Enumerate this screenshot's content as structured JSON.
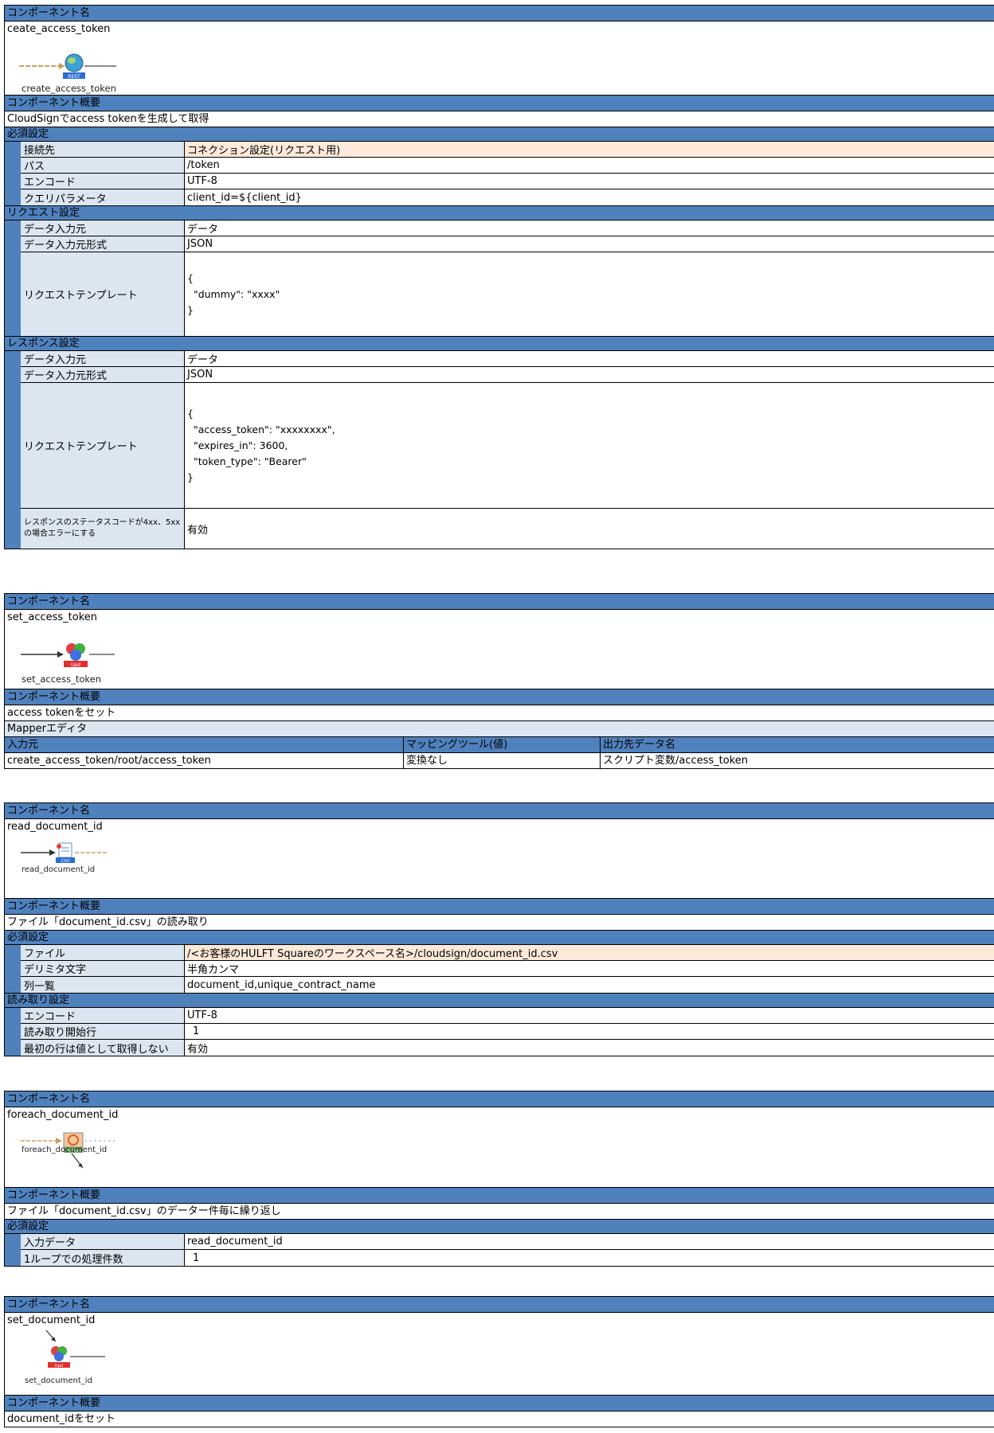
{
  "labels": {
    "component_name": "コンポーネント名",
    "component_summary": "コンポーネント概要"
  },
  "blocks": [
    {
      "name": "ceate_access_token",
      "icon_caption": "create_access_token",
      "icon_name": "rest-globe-icon",
      "icon_badge": "REST",
      "summary": "CloudSignでaccess tokenを生成して取得",
      "required_title": "必須設定",
      "required": [
        {
          "label": "接続先",
          "value": "コネクション設定(リクエスト用)"
        },
        {
          "label": "パス",
          "value": "/token"
        },
        {
          "label": "エンコード",
          "value": "UTF-8"
        },
        {
          "label": "クエリパラメータ",
          "value": "client_id=${client_id}"
        }
      ],
      "request_title": "リクエスト設定",
      "request": [
        {
          "label": "データ入力元",
          "value": "データ"
        },
        {
          "label": "データ入力元形式",
          "value": "JSON"
        },
        {
          "label": "リクエストテンプレート",
          "value": "{\n  \"dummy\": \"xxxx\"\n}"
        }
      ],
      "response_title": "レスポンス設定",
      "response": [
        {
          "label": "データ入力元",
          "value": "データ"
        },
        {
          "label": "データ入力元形式",
          "value": "JSON"
        },
        {
          "label": "リクエストテンプレート",
          "value": "{\n  \"access_token\": \"xxxxxxxx\",\n  \"expires_in\": 3600,\n  \"token_type\": \"Bearer\"\n}"
        },
        {
          "label": "レスポンスのステータスコードが4xx、5xxの場合エラーにする",
          "value": "有効"
        }
      ]
    },
    {
      "name": "set_access_token",
      "icon_caption": "set_access_token",
      "icon_name": "mapper-icon",
      "icon_badge": "Upd",
      "summary": "access tokenをセット",
      "mapper_title": "Mapperエディタ",
      "mapper_headers": [
        "入力元",
        "マッピングツール(値)",
        "出力先データ名"
      ],
      "mapper_rows": [
        [
          "create_access_token/root/access_token",
          "変換なし",
          "スクリプト変数/access_token"
        ]
      ]
    },
    {
      "name": "read_document_id",
      "icon_caption": "read_document_id",
      "icon_name": "csv-file-icon",
      "icon_badge": "CSV",
      "summary": "ファイル「document_id.csv」の読み取り",
      "required_title": "必須設定",
      "required": [
        {
          "label": "ファイル",
          "value": "/<お客様のHULFT Squareのワークスペース名>/cloudsign/document_id.csv"
        },
        {
          "label": "デリミタ文字",
          "value": "半角カンマ"
        },
        {
          "label": "列一覧",
          "value": "document_id,unique_contract_name"
        }
      ],
      "read_title": "読み取り設定",
      "read": [
        {
          "label": "エンコード",
          "value": "UTF-8"
        },
        {
          "label": "読み取り開始行",
          "value": "1"
        },
        {
          "label": "最初の行は値として取得しない",
          "value": "有効"
        }
      ]
    },
    {
      "name": "foreach_document_id",
      "icon_caption": "foreach_document_id",
      "icon_name": "loop-icon",
      "icon_badge": "Loop",
      "summary": "ファイル「document_id.csv」のデーター件毎に繰り返し",
      "required_title": "必須設定",
      "required": [
        {
          "label": "入力データ",
          "value": "read_document_id"
        },
        {
          "label": "1ループでの処理件数",
          "value": "1"
        }
      ]
    },
    {
      "name": "set_document_id",
      "icon_caption": "set_document_id",
      "icon_name": "mapper-icon",
      "icon_badge": "Upd",
      "summary": "document_idをセット"
    }
  ],
  "colors": {
    "header": "#4f81bd",
    "label": "#dce6f1",
    "highlight": "#fde9d9"
  }
}
